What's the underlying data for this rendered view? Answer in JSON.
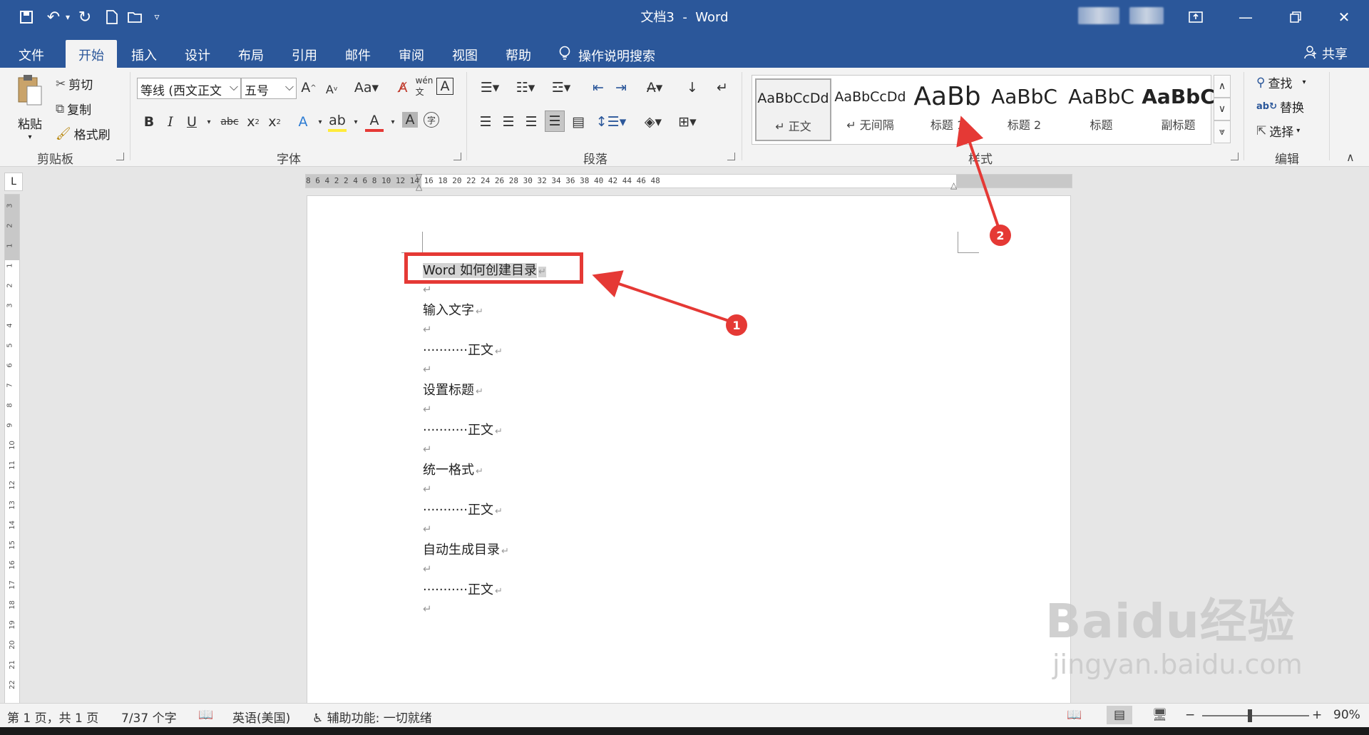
{
  "titlebar": {
    "document": "文档3",
    "separator": "-",
    "app": "Word",
    "quick_access": [
      "save-icon",
      "undo-icon",
      "redo-icon",
      "new-document-icon",
      "open-icon",
      "customize-icon"
    ]
  },
  "tabs": [
    {
      "label": "文件"
    },
    {
      "label": "开始"
    },
    {
      "label": "插入"
    },
    {
      "label": "设计"
    },
    {
      "label": "布局"
    },
    {
      "label": "引用"
    },
    {
      "label": "邮件"
    },
    {
      "label": "审阅"
    },
    {
      "label": "视图"
    },
    {
      "label": "帮助"
    }
  ],
  "tell_me": "操作说明搜索",
  "share": "共享",
  "clipboard": {
    "paste": "粘贴",
    "cut": "剪切",
    "copy": "复制",
    "format_painter": "格式刷",
    "label": "剪贴板"
  },
  "font": {
    "name": "等线 (西文正文",
    "size": "五号",
    "label": "字体"
  },
  "paragraph": {
    "label": "段落"
  },
  "styles": {
    "label": "样式",
    "items": [
      {
        "sample": "AaBbCcDd",
        "name": "正文",
        "prefix": "↵"
      },
      {
        "sample": "AaBbCcDd",
        "name": "无间隔",
        "prefix": "↵"
      },
      {
        "sample": "AaBb",
        "name": "标题 1"
      },
      {
        "sample": "AaBbC",
        "name": "标题 2"
      },
      {
        "sample": "AaBbC",
        "name": "标题"
      },
      {
        "sample": "AaBbC",
        "name": "副标题"
      }
    ]
  },
  "editing": {
    "find": "查找",
    "replace": "替换",
    "select": "选择",
    "label": "编辑"
  },
  "ruler": {
    "marks": "8  6  4  2     2  4  6  8  10  12  14  16  18  20  22  24  26  28  30  32  34  36  38  40  42  44  46  48"
  },
  "document": {
    "lines": [
      {
        "text": "Word 如何创建目录",
        "highlight": true
      },
      {
        "text": ""
      },
      {
        "text": "输入文字"
      },
      {
        "text": ""
      },
      {
        "text": "···········正文"
      },
      {
        "text": ""
      },
      {
        "text": "设置标题"
      },
      {
        "text": ""
      },
      {
        "text": "···········正文"
      },
      {
        "text": ""
      },
      {
        "text": "统一格式"
      },
      {
        "text": ""
      },
      {
        "text": "···········正文"
      },
      {
        "text": ""
      },
      {
        "text": "自动生成目录"
      },
      {
        "text": ""
      },
      {
        "text": "···········正文"
      },
      {
        "text": ""
      }
    ],
    "paragraph_mark": "↵"
  },
  "annotations": {
    "badge1": "1",
    "badge2": "2",
    "color": "#e53935"
  },
  "watermark": {
    "main": "Baidu经验",
    "url": "jingyan.baidu.com"
  },
  "statusbar": {
    "page": "第 1 页，共 1 页",
    "words": "7/37 个字",
    "language": "英语(美国)",
    "accessibility": "辅助功能: 一切就绪",
    "zoom_minus": "−",
    "zoom_plus": "+",
    "zoom": "90%"
  },
  "colors": {
    "accent": "#2b579a",
    "ribbon": "#f3f3f3"
  }
}
